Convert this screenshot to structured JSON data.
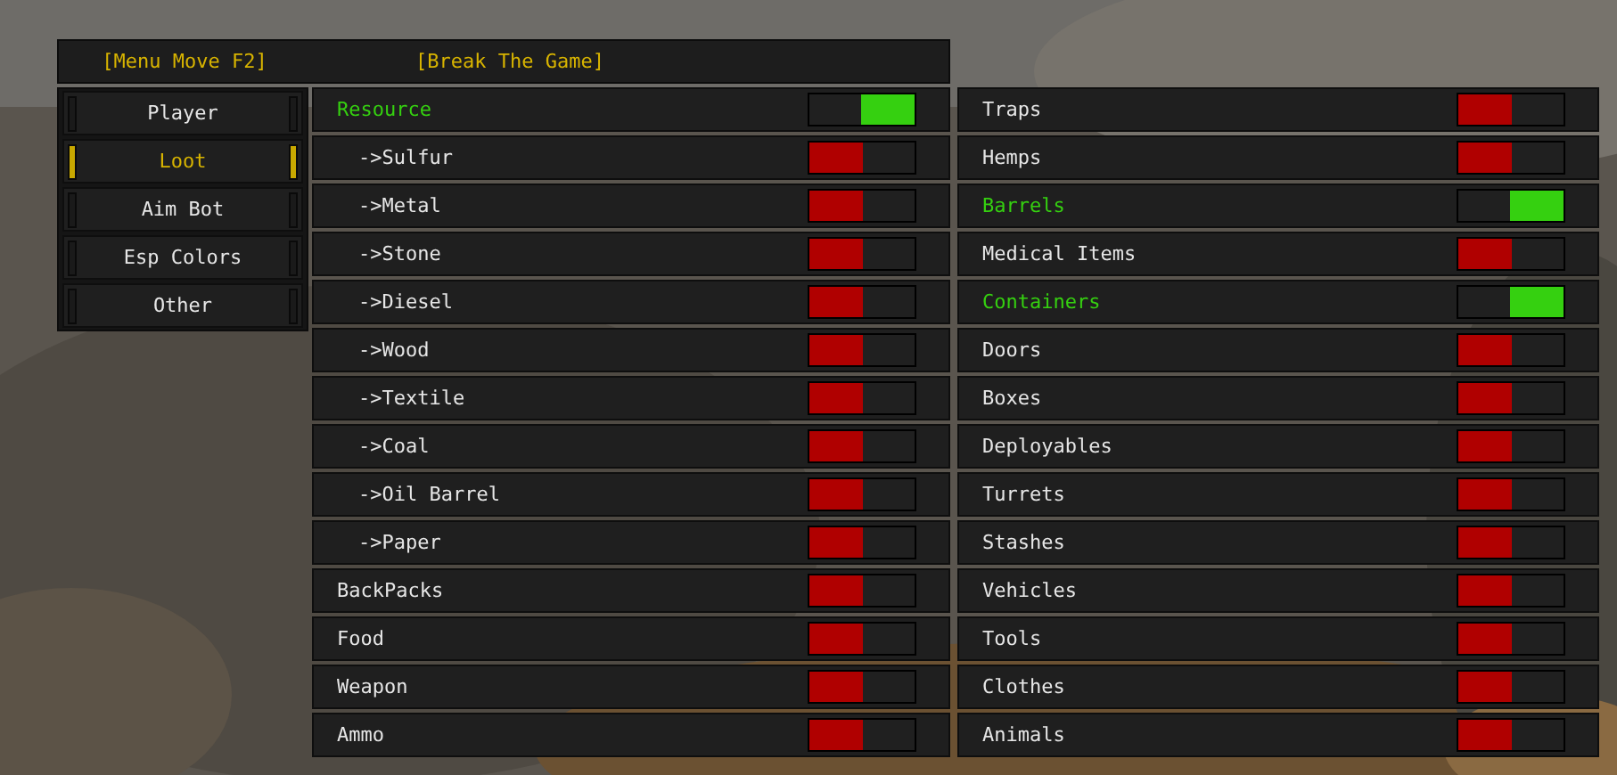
{
  "header": {
    "move_label": "[Menu Move F2]",
    "title": "[Break The Game]"
  },
  "tabs": [
    {
      "label": "Player",
      "selected": false
    },
    {
      "label": "Loot",
      "selected": true
    },
    {
      "label": "Aim Bot",
      "selected": false
    },
    {
      "label": "Esp Colors",
      "selected": false
    },
    {
      "label": "Other",
      "selected": false
    }
  ],
  "left_list": [
    {
      "label": "Resource",
      "kind": "main",
      "on": true
    },
    {
      "label": "->Sulfur",
      "kind": "sub",
      "on": false
    },
    {
      "label": "->Metal",
      "kind": "sub",
      "on": false
    },
    {
      "label": "->Stone",
      "kind": "sub",
      "on": false
    },
    {
      "label": "->Diesel",
      "kind": "sub",
      "on": false
    },
    {
      "label": "->Wood",
      "kind": "sub",
      "on": false
    },
    {
      "label": "->Textile",
      "kind": "sub",
      "on": false
    },
    {
      "label": "->Coal",
      "kind": "sub",
      "on": false
    },
    {
      "label": "->Oil Barrel",
      "kind": "sub",
      "on": false
    },
    {
      "label": "->Paper",
      "kind": "sub",
      "on": false
    },
    {
      "label": "BackPacks",
      "kind": "main",
      "on": false
    },
    {
      "label": "Food",
      "kind": "main",
      "on": false
    },
    {
      "label": "Weapon",
      "kind": "main",
      "on": false
    },
    {
      "label": "Ammo",
      "kind": "main",
      "on": false
    }
  ],
  "right_list": [
    {
      "label": "Traps",
      "kind": "main",
      "on": false
    },
    {
      "label": "Hemps",
      "kind": "main",
      "on": false
    },
    {
      "label": "Barrels",
      "kind": "main",
      "on": true
    },
    {
      "label": "Medical Items",
      "kind": "main",
      "on": false
    },
    {
      "label": "Containers",
      "kind": "main",
      "on": true
    },
    {
      "label": "Doors",
      "kind": "main",
      "on": false
    },
    {
      "label": "Boxes",
      "kind": "main",
      "on": false
    },
    {
      "label": "Deployables",
      "kind": "main",
      "on": false
    },
    {
      "label": "Turrets",
      "kind": "main",
      "on": false
    },
    {
      "label": "Stashes",
      "kind": "main",
      "on": false
    },
    {
      "label": "Vehicles",
      "kind": "main",
      "on": false
    },
    {
      "label": "Tools",
      "kind": "main",
      "on": false
    },
    {
      "label": "Clothes",
      "kind": "main",
      "on": false
    },
    {
      "label": "Animals",
      "kind": "main",
      "on": false
    }
  ]
}
